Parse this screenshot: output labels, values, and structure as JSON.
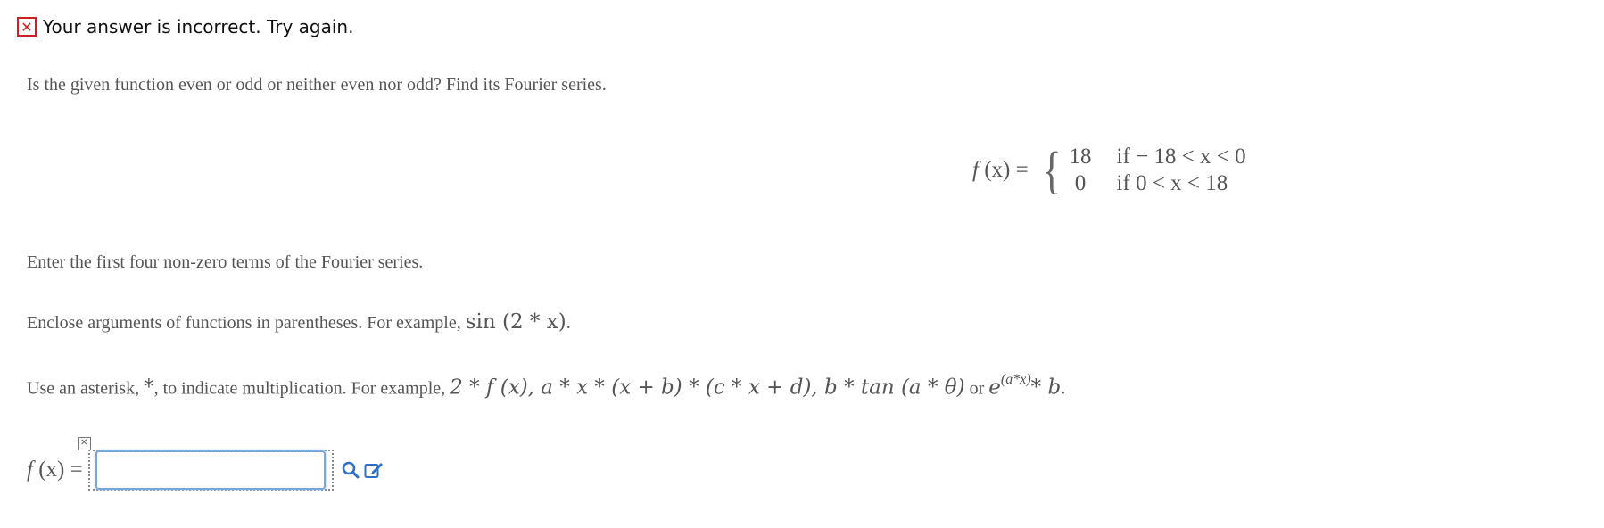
{
  "feedback": {
    "icon": "close-icon",
    "text": "Your answer is incorrect.  Try again.",
    "color": "#cc1f1f"
  },
  "question": {
    "prompt": "Is the given function even or odd or neither even nor odd? Find its Fourier series.",
    "function": {
      "lhs_name": "f",
      "lhs_arg": " (x) =",
      "rows": [
        {
          "value": "18",
          "condition": "if  − 18 < x < 0"
        },
        {
          "value": "0",
          "condition": "if  0 < x < 18"
        }
      ]
    },
    "instruction1": "Enter the first four non-zero terms of the Fourier series.",
    "instruction2_text": "Enclose arguments of functions in parentheses. For example, ",
    "instruction2_math": "sin (2 * x)",
    "instruction2_end": ".",
    "instruction3_text": "Use an asterisk, ",
    "instruction3_star": "*",
    "instruction3_text2": ", to indicate multiplication. For example, ",
    "instruction3_math": "2 * f (x), a * x * (x + b) * (c * x + d), b * tan (a * θ)",
    "instruction3_or": " or ",
    "instruction3_e": "e",
    "instruction3_exp": "(a*x)",
    "instruction3_tail": "* b",
    "instruction3_end": "."
  },
  "answer": {
    "lhs_name": "f",
    "lhs_arg": " (x) =",
    "input_value": "",
    "clear_icon": "close-icon",
    "search_icon": "search-icon",
    "edit_icon": "edit-icon",
    "accent": "#2a6fc9"
  }
}
